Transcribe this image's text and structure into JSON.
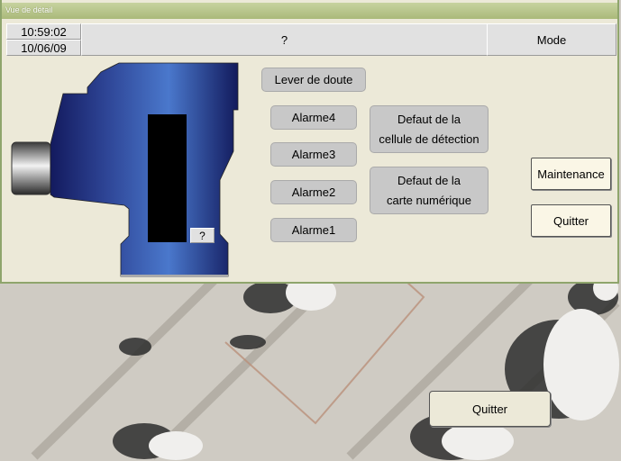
{
  "window": {
    "title": "Vue de détail"
  },
  "header": {
    "time": "10:59:02",
    "date": "10/06/09",
    "status": "?",
    "mode": "Mode"
  },
  "detector": {
    "value": "?"
  },
  "buttons": {
    "lever": "Lever de doute",
    "alarme4": "Alarme4",
    "alarme3": "Alarme3",
    "alarme2": "Alarme2",
    "alarme1": "Alarme1",
    "defaut_cellule": [
      "Defaut de la",
      "cellule de détection"
    ],
    "defaut_carte": [
      "Defaut de la",
      "carte numérique"
    ],
    "maintenance": "Maintenance",
    "quitter": "Quitter"
  },
  "map": {
    "quitter": "Quitter"
  }
}
